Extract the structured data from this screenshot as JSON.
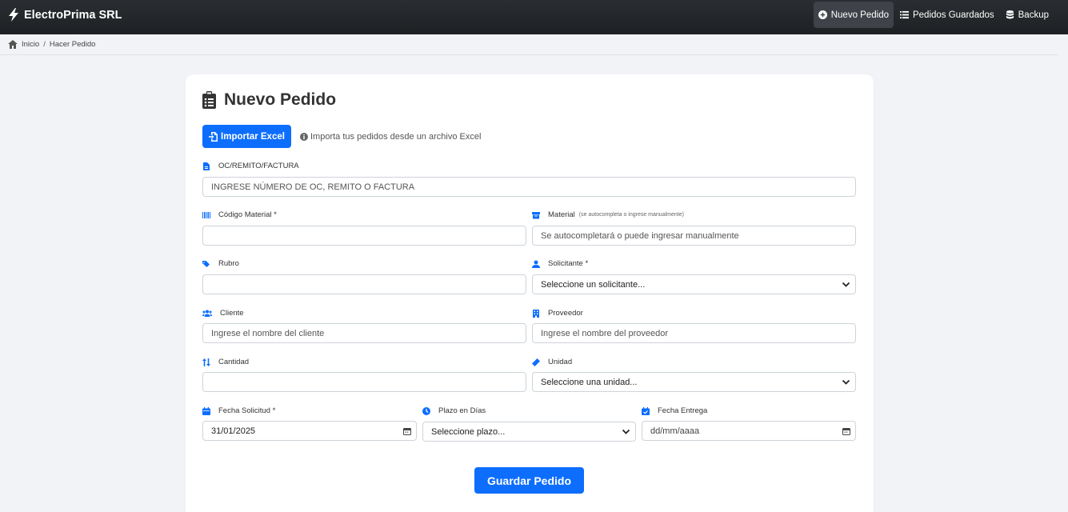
{
  "navbar": {
    "brand": "ElectroPrima SRL",
    "items": [
      {
        "label": "Nuevo Pedido",
        "icon": "plus-circle-icon",
        "active": true
      },
      {
        "label": "Pedidos Guardados",
        "icon": "list-icon",
        "active": false
      },
      {
        "label": "Backup",
        "icon": "database-icon",
        "active": false
      }
    ]
  },
  "breadcrumb": {
    "home": "Inicio",
    "separator": "/",
    "current": "Hacer Pedido"
  },
  "form": {
    "title": "Nuevo Pedido",
    "import_button": "Importar Excel",
    "import_help": "Importa tus pedidos desde un archivo Excel",
    "oc": {
      "label": "OC/REMITO/FACTURA",
      "placeholder": "INGRESE NÚMERO DE OC, REMITO O FACTURA"
    },
    "codigo_material": {
      "label": "Código Material *",
      "value": ""
    },
    "material": {
      "label": "Material",
      "sublabel": "(se autocompleta o ingrese manualmente)",
      "placeholder": "Se autocompletará o puede ingresar manualmente"
    },
    "rubro": {
      "label": "Rubro",
      "value": ""
    },
    "solicitante": {
      "label": "Solicitante *",
      "selected": "Seleccione un solicitante..."
    },
    "cliente": {
      "label": "Cliente",
      "placeholder": "Ingrese el nombre del cliente"
    },
    "proveedor": {
      "label": "Proveedor",
      "placeholder": "Ingrese el nombre del proveedor"
    },
    "cantidad": {
      "label": "Cantidad",
      "value": ""
    },
    "unidad": {
      "label": "Unidad",
      "selected": "Seleccione una unidad..."
    },
    "fecha_solicitud": {
      "label": "Fecha Solicitud *",
      "value": "31/01/2025"
    },
    "plazo": {
      "label": "Plazo en Días",
      "selected": "Seleccione plazo..."
    },
    "fecha_entrega": {
      "label": "Fecha Entrega",
      "placeholder": "dd/mm/aaaa"
    },
    "save_button": "Guardar Pedido"
  },
  "colors": {
    "primary": "#0d6efd",
    "navbar": "#212529",
    "icon_blue": "#0d6efd"
  }
}
